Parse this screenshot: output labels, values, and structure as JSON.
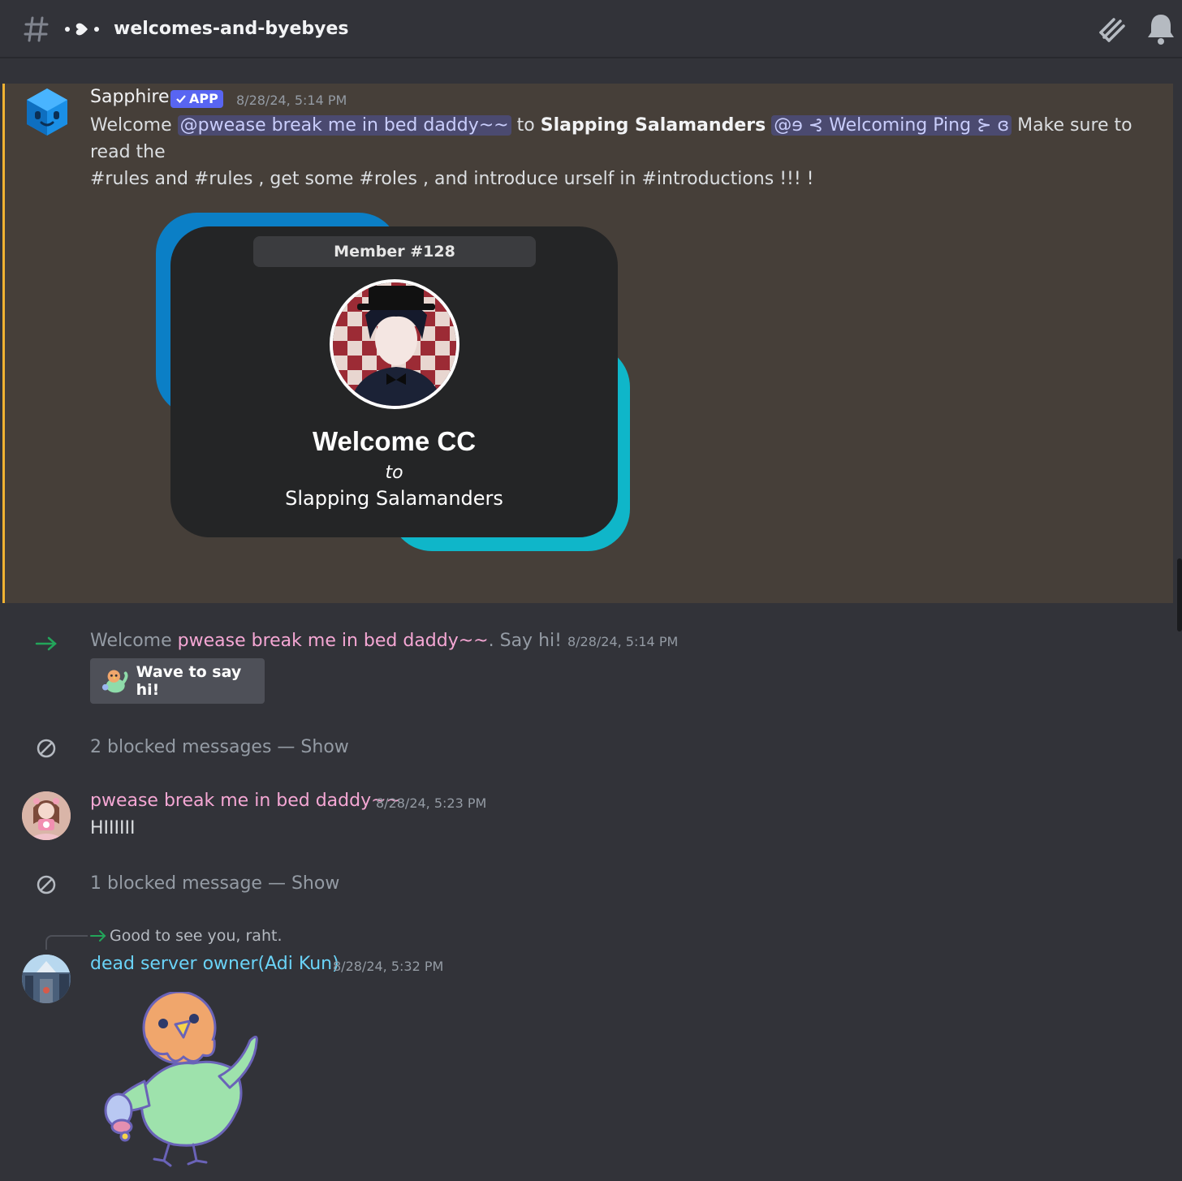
{
  "header": {
    "channel_deco": "•",
    "channel_name": "welcomes-and-byebyes"
  },
  "messages": {
    "sapphire": {
      "username": "Sapphire",
      "badge": "APP",
      "timestamp": "8/28/24, 5:14 PM",
      "text_welcome": "Welcome",
      "mention_user": "@pwease break me in bed daddy~~",
      "text_to": "to",
      "server_name": "Slapping Salamanders",
      "mention_role": "@ɘ ⊰ Welcoming Ping ⊱ ɞ",
      "text_read": "Make sure to read the",
      "line2": "#rules and #rules , get some #roles , and introduce urself in #introductions !!! !",
      "card": {
        "member_label": "Member #128",
        "welcome_title": "Welcome CC",
        "to_label": "to",
        "server": "Slapping Salamanders"
      }
    },
    "join": {
      "prefix": "Welcome",
      "user": "pwease break me in bed daddy~~",
      "suffix": ". Say hi!",
      "timestamp": "8/28/24, 5:14 PM",
      "wave_button": "Wave to say hi!"
    },
    "blocked_1": {
      "text": "2 blocked messages",
      "separator": "—",
      "show": "Show"
    },
    "pwease": {
      "username": "pwease break me in bed daddy~~",
      "timestamp": "8/28/24, 5:23 PM",
      "content": "HIIIIII"
    },
    "blocked_2": {
      "text": "1 blocked message",
      "separator": "—",
      "show": "Show"
    },
    "adi": {
      "reply_preview": "Good to see you, raht.",
      "username": "dead server owner(Adi Kun)",
      "timestamp": "8/28/24, 5:32 PM",
      "sticker": "bird-waving-sticker"
    }
  },
  "colors": {
    "background": "#323339",
    "mention_highlight": "#463f39",
    "mention_bar": "#f0b232",
    "app_badge": "#5865f2",
    "pink_name": "#f5a7d4",
    "cyan_name": "#6ad3f7",
    "join_arrow": "#23a55a"
  }
}
